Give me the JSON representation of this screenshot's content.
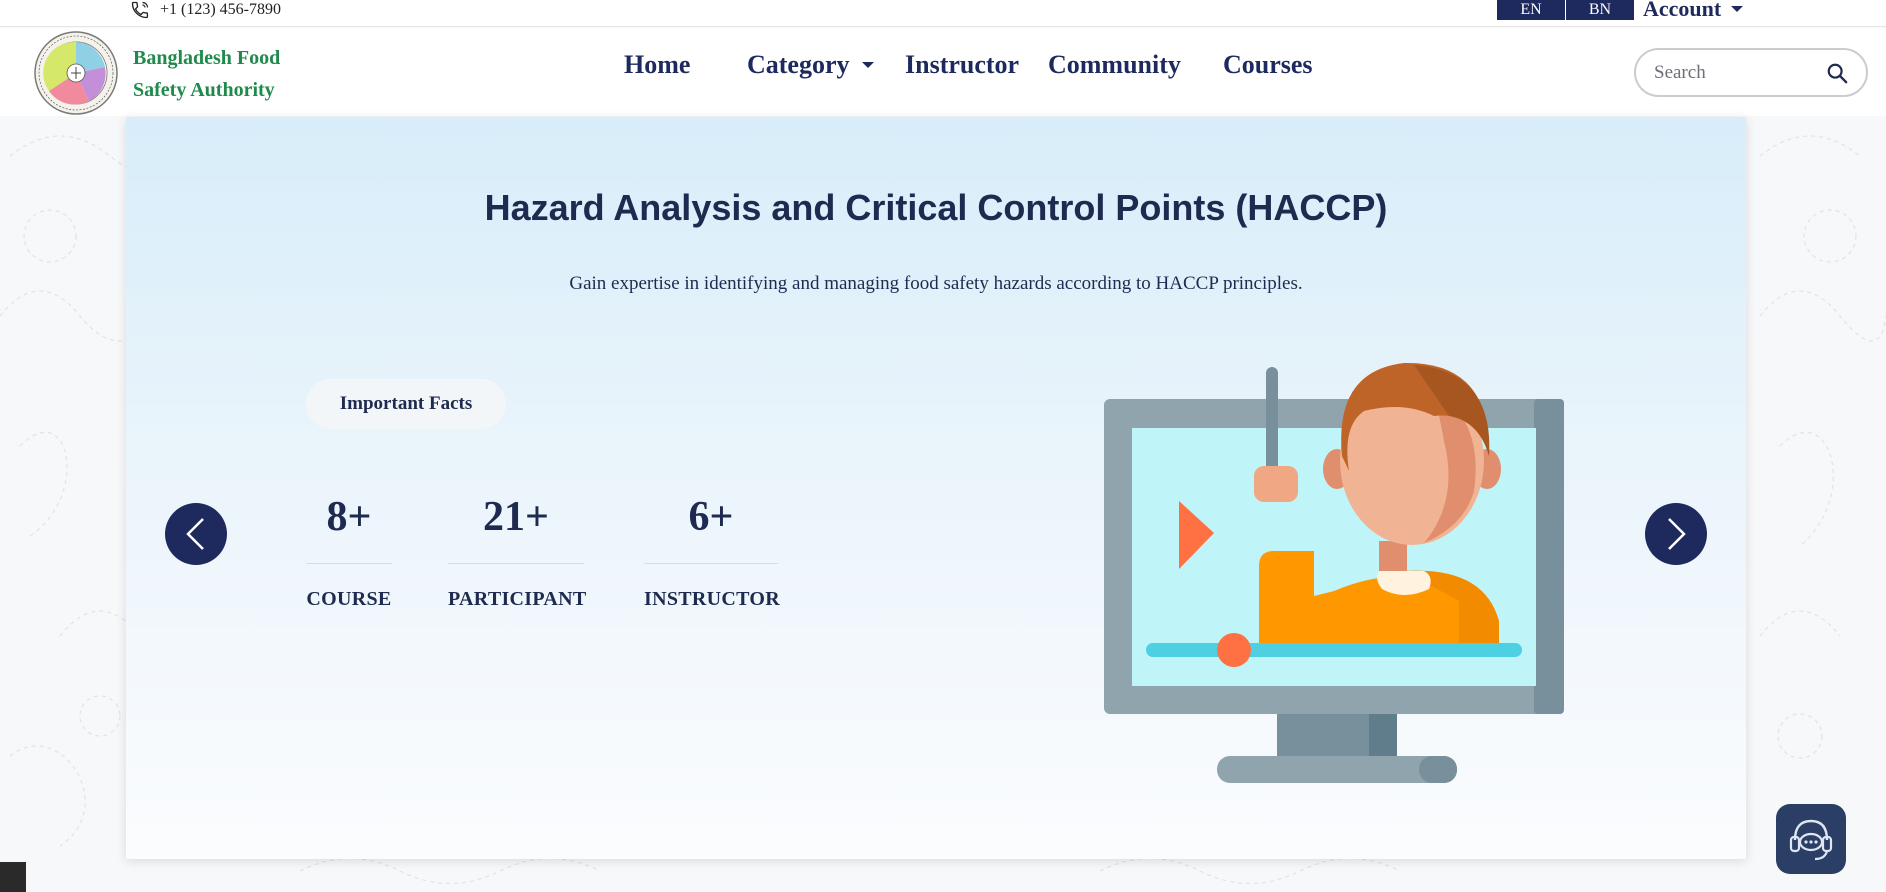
{
  "topbar": {
    "phone": "+1 (123) 456-7890",
    "lang_en": "EN",
    "lang_bn": "BN",
    "account": "Account"
  },
  "header": {
    "brand_line1": "Bangladesh Food",
    "brand_line2": "Safety Authority",
    "nav": {
      "home": "Home",
      "category": "Category",
      "instructor": "Instructor",
      "community": "Community",
      "courses": "Courses"
    },
    "search_placeholder": "Search"
  },
  "hero": {
    "title": "Hazard Analysis and Critical Control Points (HACCP)",
    "subtitle": "Gain expertise in identifying and managing food safety hazards according to HACCP principles.",
    "facts_label": "Important Facts",
    "stats": [
      {
        "value": "8+",
        "label": "COURSE"
      },
      {
        "value": "21+",
        "label": "PARTICIPANT"
      },
      {
        "value": "6+",
        "label": "INSTRUCTOR"
      }
    ]
  },
  "colors": {
    "navy": "#1e2a5e",
    "brand_green": "#1f8a4c",
    "hero_top": "#d7edf9"
  },
  "icons": [
    "phone-icon",
    "caret-down-icon",
    "search-icon",
    "chevron-left-icon",
    "chevron-right-icon",
    "support-chat-icon",
    "logo-seal"
  ]
}
